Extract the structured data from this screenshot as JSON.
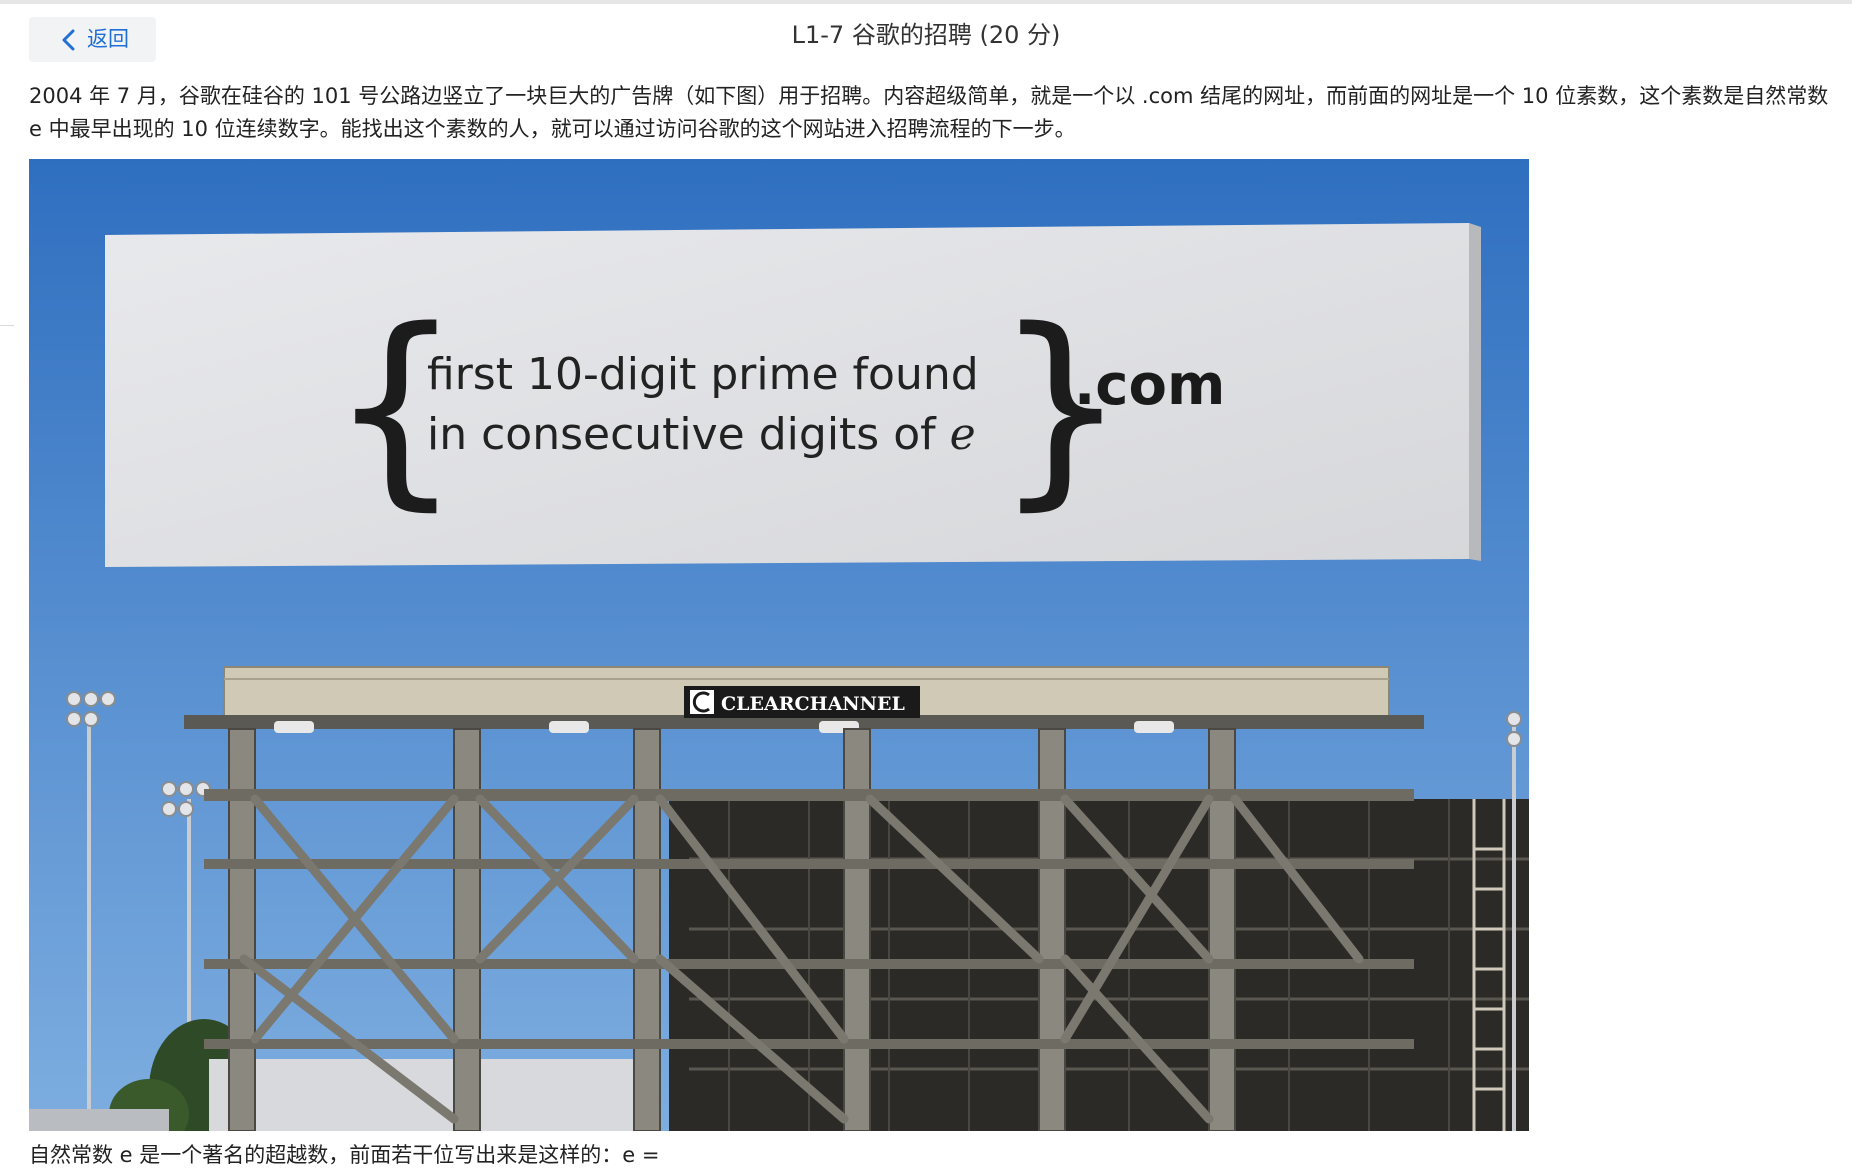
{
  "header": {
    "back_label": "返回",
    "title": "L1-7 谷歌的招聘 (20 分)"
  },
  "problem": {
    "intro": "2004 年 7 月，谷歌在硅谷的 101 号公路边竖立了一块巨大的广告牌（如下图）用于招聘。内容超级简单，就是一个以 .com 结尾的网址，而前面的网址是一个 10 位素数，这个素数是自然常数 e 中最早出现的 10 位连续数字。能找出这个素数的人，就可以通过访问谷歌的这个网站进入招聘流程的下一步。",
    "caption": "自然常数 e 是一个著名的超越数，前面若干位写出来是这样的：e ="
  },
  "billboard": {
    "line1": "first 10-digit prime found",
    "line2": "in consecutive digits of ",
    "line2_italic": "e",
    "suffix": ".com",
    "sign_text": "CLEARCHANNEL"
  },
  "colors": {
    "sky": "#3f7fc8",
    "board": "#dfe0e3",
    "link": "#1f6fd6"
  },
  "icons": {
    "back": "chevron-left-icon",
    "sign_logo": "clear-channel-logo-icon"
  }
}
